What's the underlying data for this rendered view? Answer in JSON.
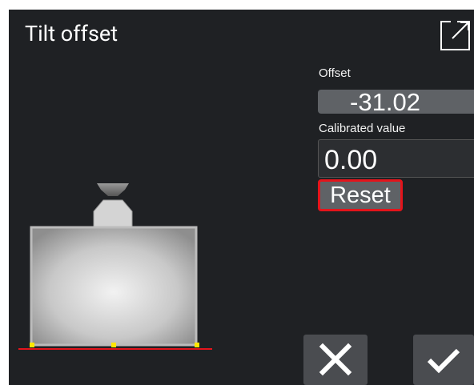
{
  "header": {
    "title": "Tilt offset",
    "expand_icon": "expand-icon"
  },
  "offset": {
    "label": "Offset",
    "value": "-31.02"
  },
  "calibrated": {
    "label": "Calibrated value",
    "value": "0.00"
  },
  "reset": {
    "label": "Reset"
  },
  "actions": {
    "cancel_icon": "close-icon",
    "confirm_icon": "check-icon"
  },
  "colors": {
    "background": "#1f2124",
    "field": "#5f6266",
    "button": "#4a4c50",
    "highlight": "#e4141b",
    "baseline": "#e4141b",
    "marker": "#ffe600"
  }
}
